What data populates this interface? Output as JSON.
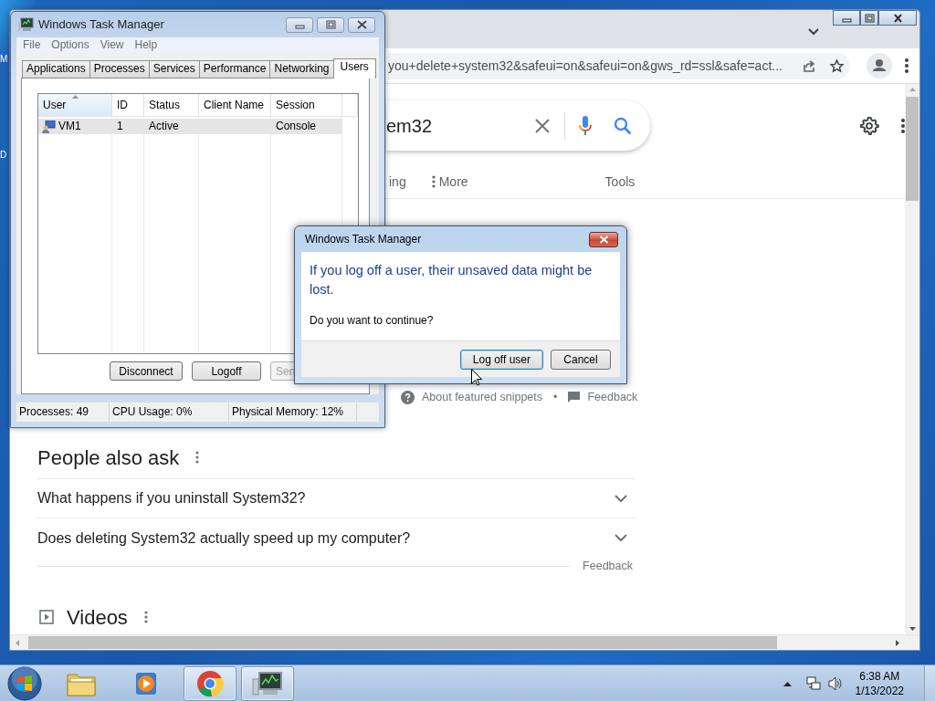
{
  "desktop": {
    "icon_labels": [
      "M",
      "D"
    ]
  },
  "browser": {
    "url": "you+delete+system32&safeui=on&safeui=on&gws_rd=ssl&safe=act...",
    "search_query": "em32",
    "search_tabs": [
      {
        "label": "ing",
        "kind": "plain"
      },
      {
        "label": "More",
        "kind": "menu"
      }
    ],
    "tools": "Tools",
    "snippet_links": [
      "About featured snippets",
      "•",
      "Feedback"
    ],
    "people_also_ask": {
      "title": "People also ask",
      "questions": [
        {
          "text": "What happens if you uninstall System32?",
          "expanded": false
        },
        {
          "text": "Does deleting System32 actually speed up my computer?",
          "expanded": false
        }
      ],
      "feedback": "Feedback"
    },
    "videos_title": "Videos"
  },
  "task_manager": {
    "title": "Windows Task Manager",
    "menu": [
      "File",
      "Options",
      "View",
      "Help"
    ],
    "tabs": [
      {
        "label": "Applications",
        "selected": false
      },
      {
        "label": "Processes",
        "selected": false
      },
      {
        "label": "Services",
        "selected": false
      },
      {
        "label": "Performance",
        "selected": false
      },
      {
        "label": "Networking",
        "selected": false
      },
      {
        "label": "Users",
        "selected": true
      }
    ],
    "columns": [
      {
        "label": "User",
        "sorted": true
      },
      {
        "label": "ID",
        "sorted": false
      },
      {
        "label": "Status",
        "sorted": false
      },
      {
        "label": "Client Name",
        "sorted": false
      },
      {
        "label": "Session",
        "sorted": false
      }
    ],
    "rows": [
      {
        "user": "VM1",
        "id": "1",
        "status": "Active",
        "session": "Console",
        "selected": true
      }
    ],
    "buttons": [
      {
        "label": "Disconnect",
        "disabled": false
      },
      {
        "label": "Logoff",
        "disabled": false
      },
      {
        "label": "Sen",
        "disabled": true
      }
    ],
    "status_bar": [
      "Processes: 49",
      "CPU Usage: 0%",
      "Physical Memory: 12%"
    ]
  },
  "dialog": {
    "title": "Windows Task Manager",
    "main_instruction": "If you log off a user, their unsaved data might be lost.",
    "content": "Do you want to continue?",
    "buttons": [
      {
        "label": "Log off user",
        "default": true
      },
      {
        "label": "Cancel",
        "default": false
      }
    ]
  },
  "taskbar": {
    "apps": [
      {
        "kind": "folder",
        "active": false
      },
      {
        "kind": "media",
        "active": false
      },
      {
        "kind": "browser",
        "active": true
      },
      {
        "kind": "taskmgr",
        "active": true
      }
    ],
    "time": "6:38 AM",
    "date": "1/13/2022"
  }
}
